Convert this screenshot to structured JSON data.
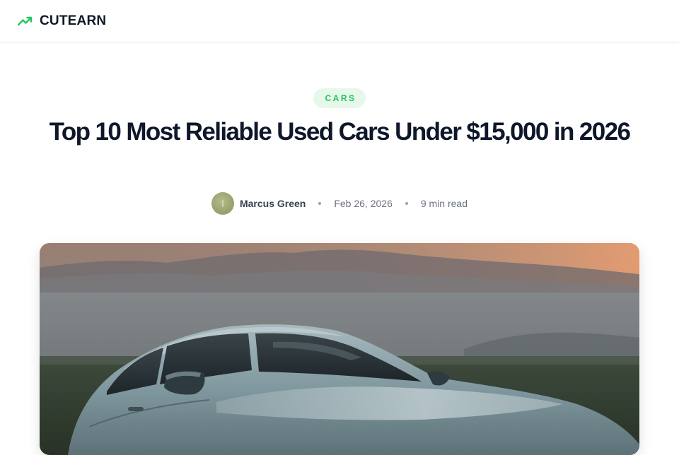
{
  "header": {
    "brand_name": "CUTEARN",
    "brand_icon": "trending-up-icon",
    "accent_color": "#22c55e"
  },
  "article": {
    "category": "CARS",
    "title": "Top 10 Most Reliable Used Cars Under $15,000 in 2026",
    "author": {
      "name": "Marcus Green",
      "avatar": "avatar-image"
    },
    "date": "Feb 26, 2026",
    "read_time": "9 min read",
    "hero_image": "car-sunset-image"
  }
}
